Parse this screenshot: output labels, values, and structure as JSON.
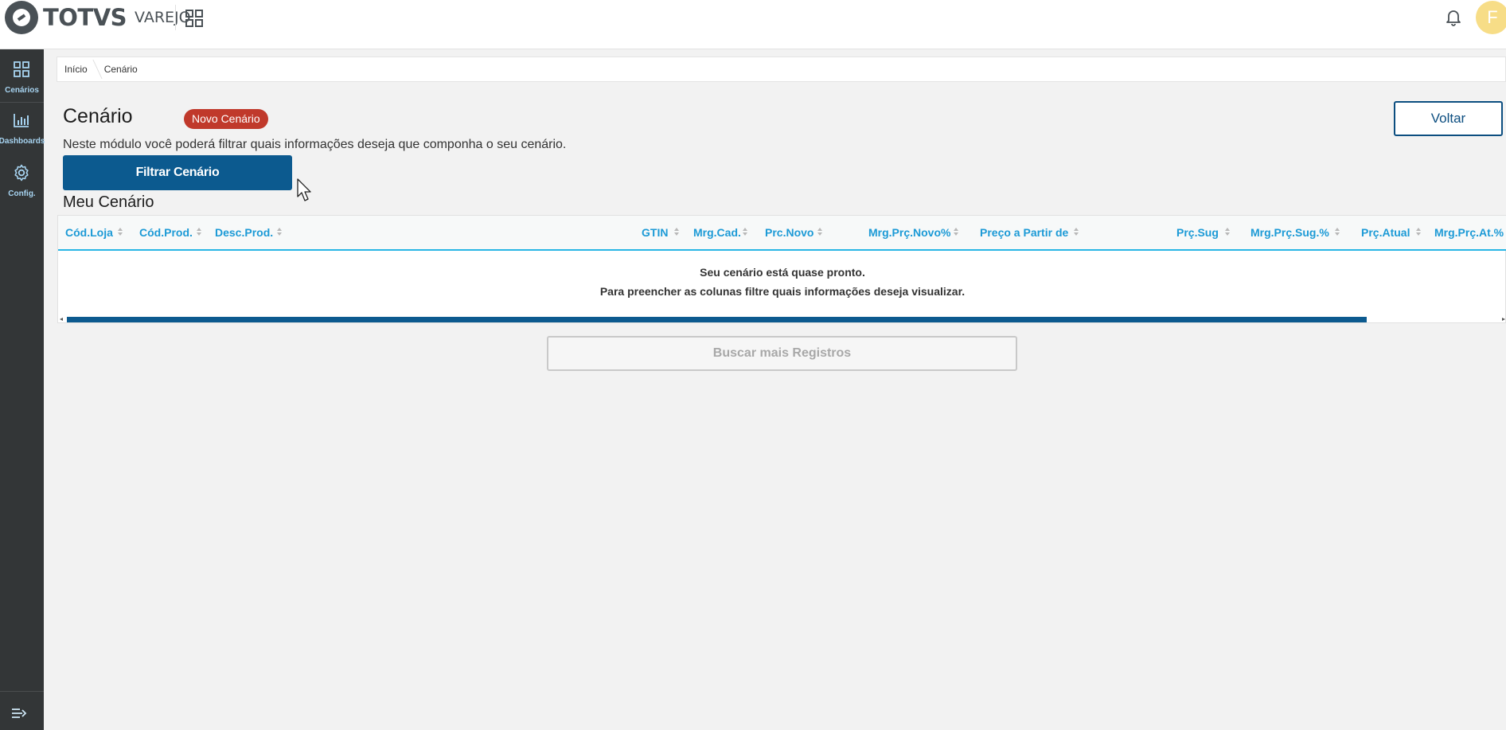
{
  "header": {
    "logo_text": "TOTVS",
    "logo_sub": "VAREJO",
    "avatar_initial": "F"
  },
  "sidebar": {
    "items": [
      {
        "label": "Cenários",
        "icon": "grid-icon"
      },
      {
        "label": "Dashboards",
        "icon": "bar-chart-icon"
      },
      {
        "label": "Config.",
        "icon": "gear-icon"
      }
    ],
    "collapse_icon": "expand-menu-icon"
  },
  "breadcrumb": [
    "Início",
    "Cenário"
  ],
  "page": {
    "title": "Cenário",
    "badge": "Novo Cenário",
    "back_label": "Voltar",
    "description": "Neste módulo você poderá filtrar quais informações deseja que componha o seu cenário.",
    "filter_label": "Filtrar Cenário",
    "section_title": "Meu Cenário",
    "load_more_label": "Buscar mais Registros"
  },
  "table": {
    "columns": [
      "Cód.Loja",
      "Cód.Prod.",
      "Desc.Prod.",
      "GTIN",
      "Mrg.Cad.",
      "Prc.Novo",
      "Mrg.Prç.Novo%",
      "Preço a Partir de",
      "Prç.Sug",
      "Mrg.Prç.Sug.%",
      "Prç.Atual",
      "Mrg.Prç.At.%"
    ],
    "empty_line1": "Seu cenário está quase pronto.",
    "empty_line2": "Para preencher as colunas filtre quais informações deseja visualizar."
  },
  "colors": {
    "primary": "#0c5a8f",
    "header_text": "#1c9ad6",
    "badge": "#c0392b",
    "sidebar_bg": "#333637",
    "avatar": "#f7dd87"
  }
}
